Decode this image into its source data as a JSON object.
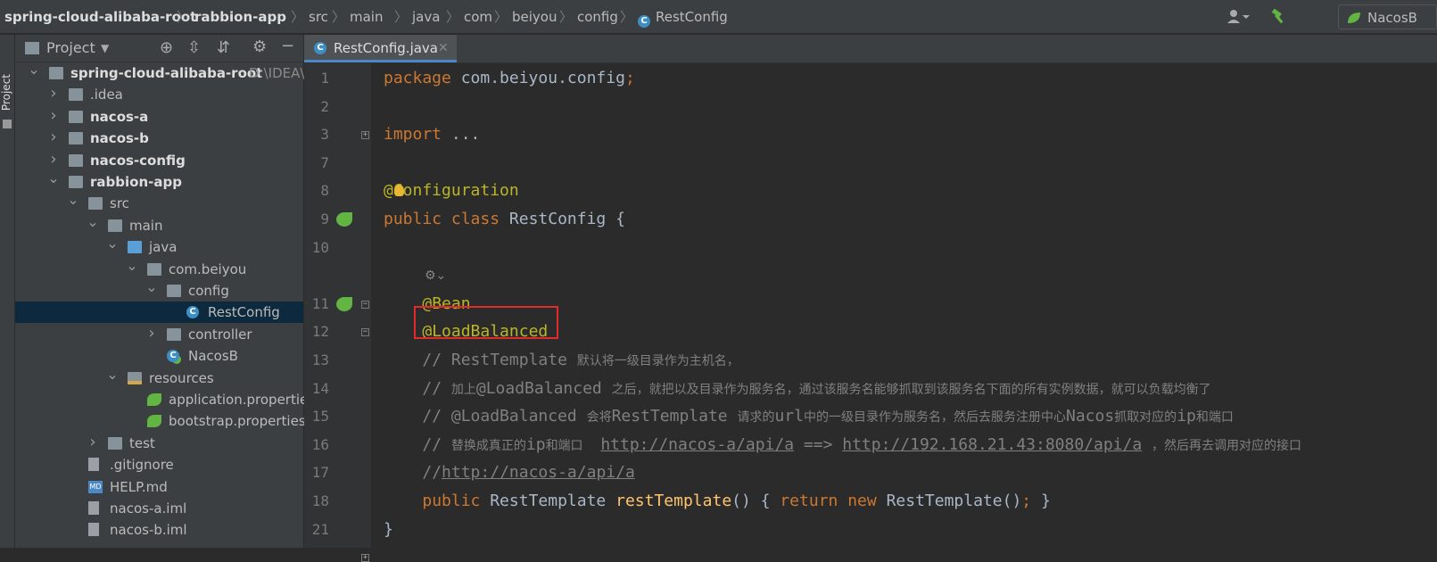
{
  "breadcrumb": {
    "items": [
      "spring-cloud-alibaba-root",
      "rabbion-app",
      "src",
      "main",
      "java",
      "com",
      "beiyou",
      "config",
      "RestConfig"
    ]
  },
  "toolbar": {
    "run_config": "NacosB"
  },
  "side_stripe": {
    "label": "Project"
  },
  "project_panel": {
    "title": "Project",
    "tree": [
      {
        "label": "spring-cloud-alibaba-root",
        "hint": "D:\\IDEA\\spr",
        "depth": 0,
        "expanded": true,
        "icon": "module-folder-icon",
        "bold": true
      },
      {
        "label": ".idea",
        "depth": 1,
        "expanded": false,
        "icon": "folder-icon"
      },
      {
        "label": "nacos-a",
        "depth": 1,
        "expanded": false,
        "icon": "module-folder-icon",
        "bold": true
      },
      {
        "label": "nacos-b",
        "depth": 1,
        "expanded": false,
        "icon": "module-folder-icon",
        "bold": true
      },
      {
        "label": "nacos-config",
        "depth": 1,
        "expanded": false,
        "icon": "module-folder-icon",
        "bold": true
      },
      {
        "label": "rabbion-app",
        "depth": 1,
        "expanded": true,
        "icon": "module-folder-icon",
        "bold": true
      },
      {
        "label": "src",
        "depth": 2,
        "expanded": true,
        "icon": "folder-icon"
      },
      {
        "label": "main",
        "depth": 3,
        "expanded": true,
        "icon": "folder-icon"
      },
      {
        "label": "java",
        "depth": 4,
        "expanded": true,
        "icon": "source-folder-icon"
      },
      {
        "label": "com.beiyou",
        "depth": 5,
        "expanded": true,
        "icon": "package-icon"
      },
      {
        "label": "config",
        "depth": 6,
        "expanded": true,
        "icon": "package-icon"
      },
      {
        "label": "RestConfig",
        "depth": 7,
        "icon": "class-icon",
        "selected": true
      },
      {
        "label": "controller",
        "depth": 6,
        "expanded": false,
        "icon": "package-icon"
      },
      {
        "label": "NacosB",
        "depth": 6,
        "icon": "spring-class-icon"
      },
      {
        "label": "resources",
        "depth": 4,
        "expanded": true,
        "icon": "resources-folder-icon"
      },
      {
        "label": "application.properties",
        "depth": 5,
        "icon": "properties-icon"
      },
      {
        "label": "bootstrap.properties",
        "depth": 5,
        "icon": "properties-icon"
      },
      {
        "label": "test",
        "depth": 3,
        "expanded": false,
        "icon": "folder-icon"
      },
      {
        "label": ".gitignore",
        "depth": 2,
        "icon": "gitignore-icon"
      },
      {
        "label": "HELP.md",
        "depth": 2,
        "icon": "markdown-icon"
      },
      {
        "label": "nacos-a.iml",
        "depth": 2,
        "icon": "iml-icon"
      },
      {
        "label": "nacos-b.iml",
        "depth": 2,
        "icon": "iml-icon"
      }
    ]
  },
  "editor": {
    "tab_label": "RestConfig.java",
    "lines": [
      {
        "num": "1",
        "tokens": [
          [
            "kw",
            "package "
          ],
          [
            "plain",
            "com.beiyou.config"
          ],
          [
            "kw",
            ";"
          ]
        ]
      },
      {
        "num": "2",
        "tokens": []
      },
      {
        "num": "3",
        "tokens": [
          [
            "kw",
            "import "
          ],
          [
            "plain",
            "..."
          ]
        ]
      },
      {
        "num": "7",
        "tokens": []
      },
      {
        "num": "8",
        "tokens": [
          [
            "ann",
            "@Configuration"
          ]
        ]
      },
      {
        "num": "9",
        "tokens": [
          [
            "kw",
            "public class "
          ],
          [
            "plain",
            "RestConfig {"
          ]
        ]
      },
      {
        "num": "10",
        "tokens": []
      },
      {
        "num": "",
        "tokens": []
      },
      {
        "num": "11",
        "tokens": [
          [
            "plain",
            "    "
          ],
          [
            "ann",
            "@Bean"
          ]
        ]
      },
      {
        "num": "12",
        "tokens": [
          [
            "plain",
            "    "
          ],
          [
            "ann",
            "@LoadBalanced"
          ]
        ]
      },
      {
        "num": "13",
        "tokens": [
          [
            "plain",
            "    "
          ],
          [
            "cmt",
            "// RestTemplate "
          ],
          [
            "cmtcn",
            "默认将一级目录作为主机名，"
          ]
        ]
      },
      {
        "num": "14",
        "tokens": [
          [
            "plain",
            "    "
          ],
          [
            "cmt",
            "// "
          ],
          [
            "cmtcn",
            "加上"
          ],
          [
            "cmt",
            "@LoadBalanced "
          ],
          [
            "cmtcn",
            "之后，就把以及目录作为服务名，通过该服务名能够抓取到该服务名下面的所有实例数据，就可以负载均衡了"
          ]
        ]
      },
      {
        "num": "15",
        "tokens": [
          [
            "plain",
            "    "
          ],
          [
            "cmt",
            "// @LoadBalanced "
          ],
          [
            "cmtcn",
            "会将"
          ],
          [
            "cmt",
            "RestTemplate "
          ],
          [
            "cmtcn",
            "请求的"
          ],
          [
            "cmt",
            "url"
          ],
          [
            "cmtcn",
            "中的一级目录作为服务名，然后去服务注册中心"
          ],
          [
            "cmt",
            "Nacos"
          ],
          [
            "cmtcn",
            "抓取对应的"
          ],
          [
            "cmt",
            "ip"
          ],
          [
            "cmtcn",
            "和端口"
          ]
        ]
      },
      {
        "num": "16",
        "tokens": [
          [
            "plain",
            "    "
          ],
          [
            "cmt",
            "// "
          ],
          [
            "cmtcn",
            "替换成真正的"
          ],
          [
            "cmt",
            "ip"
          ],
          [
            "cmtcn",
            "和端口  "
          ],
          [
            "cmt",
            " "
          ],
          [
            "url",
            "http://nacos-a/api/a"
          ],
          [
            "cmt",
            " ==> "
          ],
          [
            "url",
            "http://192.168.21.43:8080/api/a"
          ],
          [
            "cmt",
            " "
          ],
          [
            "cmtcn",
            "，然后再去调用对应的接口"
          ]
        ]
      },
      {
        "num": "17",
        "tokens": [
          [
            "plain",
            "    "
          ],
          [
            "cmt",
            "//"
          ],
          [
            "url",
            "http://nacos-a/api/a"
          ]
        ]
      },
      {
        "num": "18",
        "tokens": [
          [
            "plain",
            "    "
          ],
          [
            "kw",
            "public "
          ],
          [
            "plain",
            "RestTemplate "
          ],
          [
            "fn",
            "restTemplate"
          ],
          [
            "plain",
            "() { "
          ],
          [
            "kw",
            "return new "
          ],
          [
            "plain",
            "RestTemplate()"
          ],
          [
            "kw",
            "; "
          ],
          [
            "plain",
            "}"
          ]
        ]
      },
      {
        "num": "21",
        "tokens": [
          [
            "plain",
            "}"
          ]
        ]
      }
    ]
  },
  "colors": {
    "keyword": "#cc7832",
    "annotation": "#bbb529",
    "comment": "#808080",
    "method": "#ffc66d",
    "highlight_box": "#e22a2a"
  }
}
